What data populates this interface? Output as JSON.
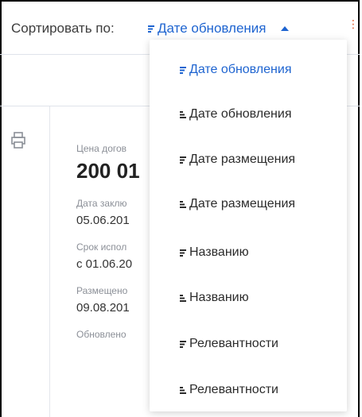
{
  "sort": {
    "label": "Сортировать по:",
    "current": "Дате обновления",
    "accent_color": "#1e64d0"
  },
  "card": {
    "price_label": "Цена догов",
    "price_value": "200 01",
    "sign_label": "Дата заклю",
    "sign_value": "05.06.201",
    "term_label": "Срок испол",
    "term_value": "с 01.06.20",
    "placed_label": "Размещено",
    "placed_value": "09.08.201",
    "updated_label": "Обновлено"
  },
  "dropdown": {
    "items": [
      {
        "label": "Дате обновления",
        "icon": "sort-desc-icon",
        "active": true
      },
      {
        "label": "Дате обновления",
        "icon": "sort-asc-icon",
        "active": false
      },
      {
        "label": "Дате размещения",
        "icon": "sort-desc-icon",
        "active": false
      },
      {
        "label": "Дате размещения",
        "icon": "sort-asc-icon",
        "active": false
      },
      {
        "label": "Названию",
        "icon": "sort-desc-icon",
        "active": false
      },
      {
        "label": "Названию",
        "icon": "sort-asc-icon",
        "active": false
      },
      {
        "label": "Релевантности",
        "icon": "sort-desc-icon",
        "active": false
      },
      {
        "label": "Релевантности",
        "icon": "sort-asc-icon",
        "active": false
      }
    ]
  }
}
